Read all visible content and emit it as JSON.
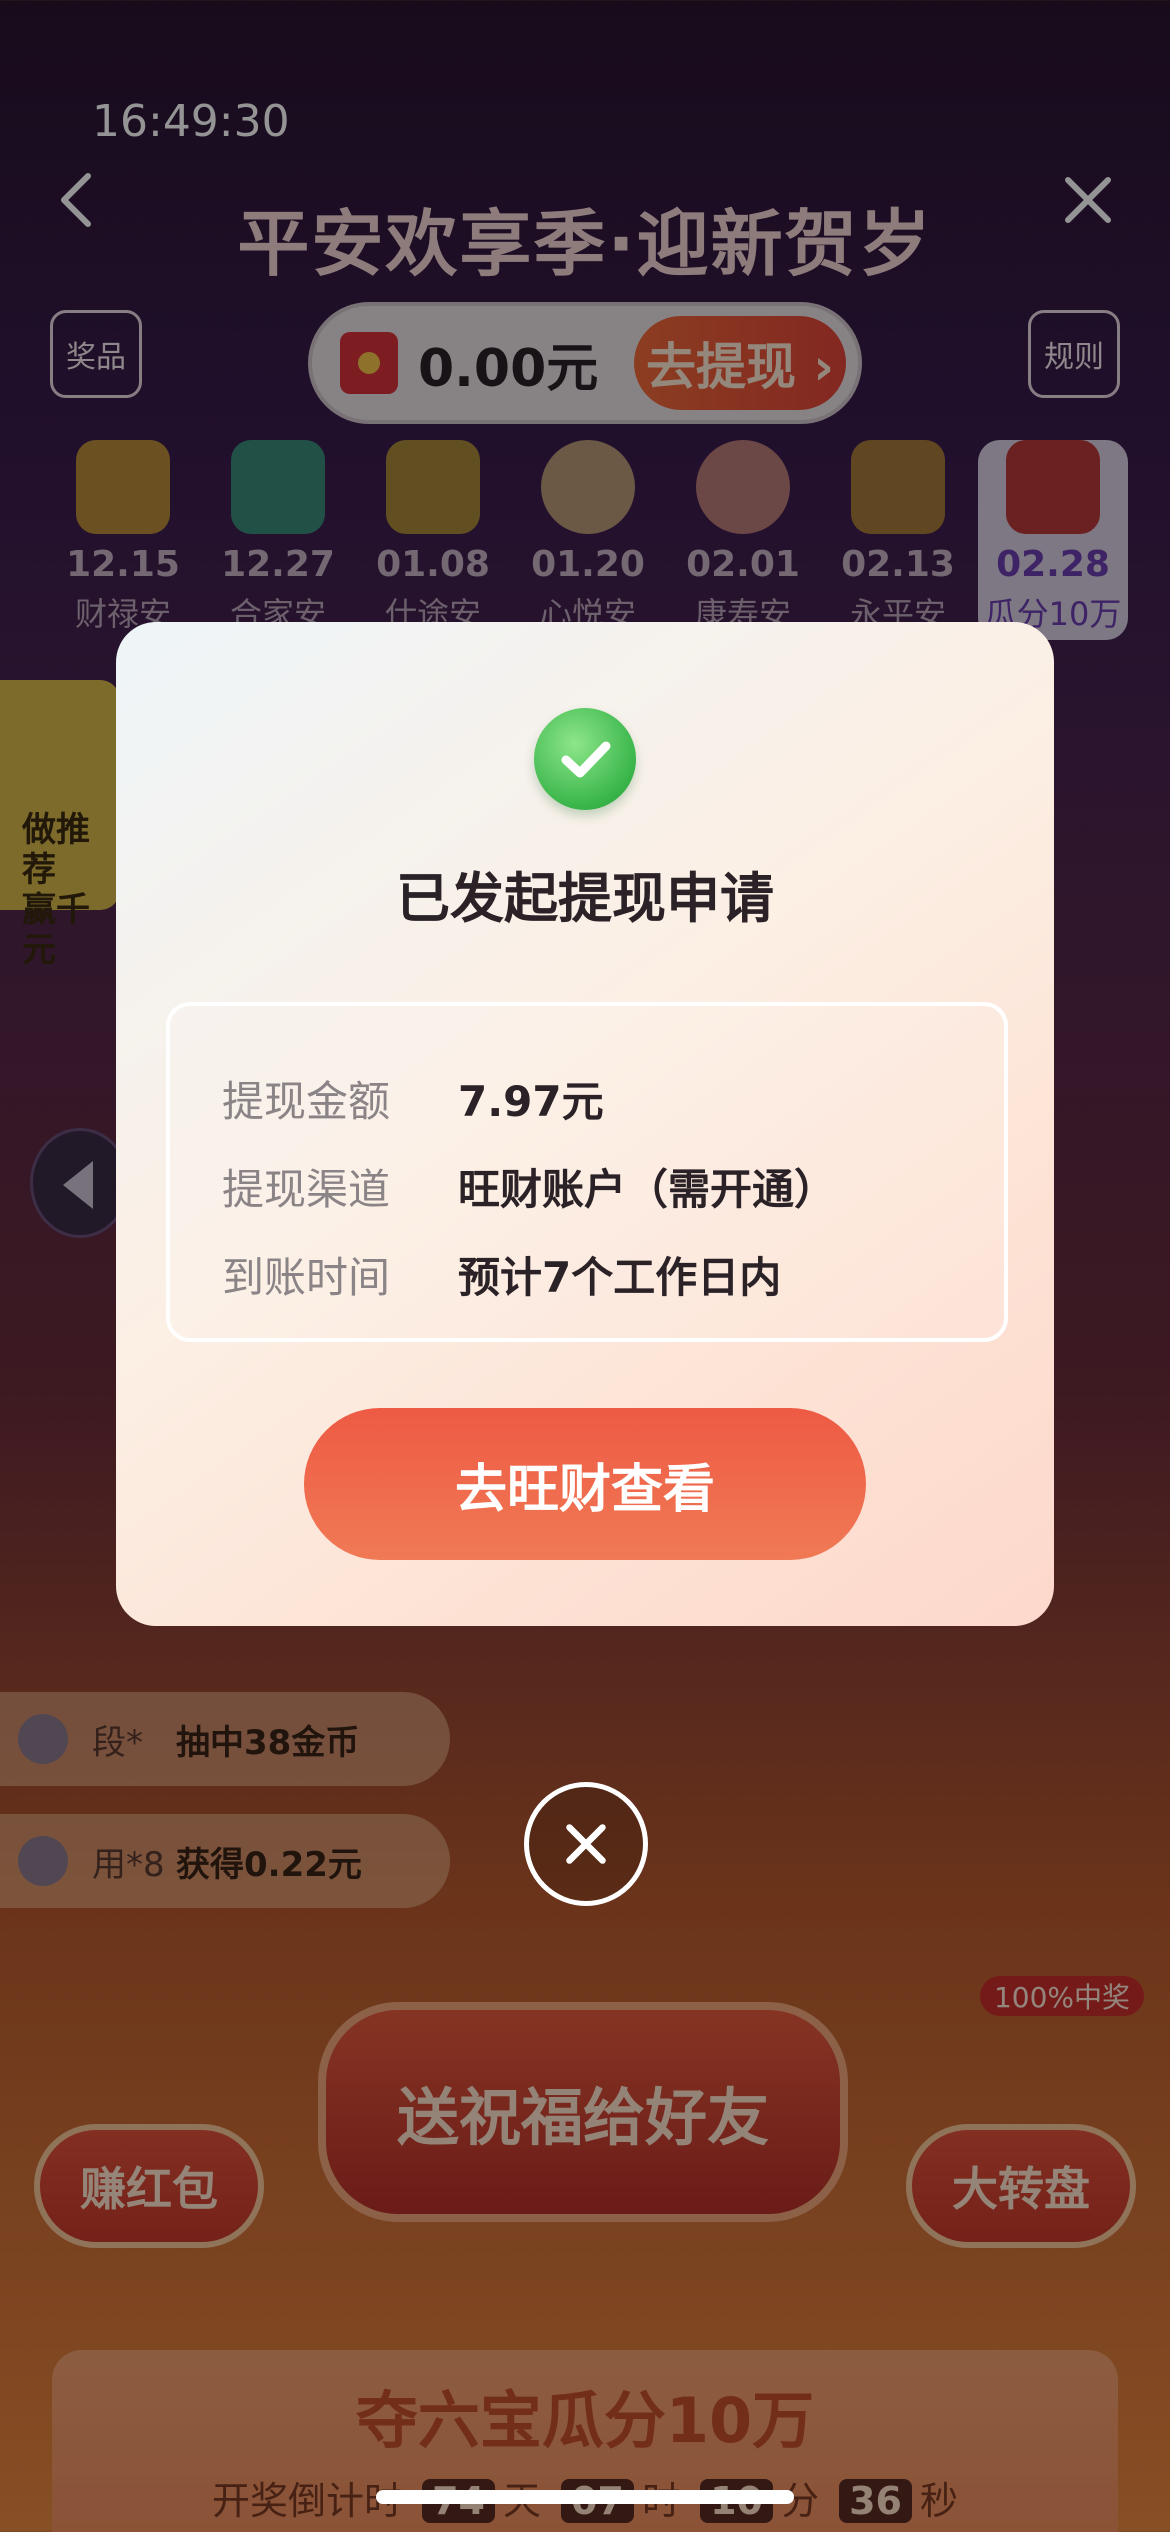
{
  "status_bar": {
    "time": "16:49:30"
  },
  "header": {
    "title": "平安欢享季·迎新贺岁",
    "back_icon": "chevron-left-icon",
    "close_icon": "close-icon"
  },
  "top_bar": {
    "prize_label": "奖品",
    "rules_label": "规则",
    "balance": "0.00元",
    "withdraw_label": "去提现 ›"
  },
  "calendar": [
    {
      "date": "12.15",
      "name": "财禄安",
      "icon": "gold-ingot-icon",
      "color": "#d9a93a"
    },
    {
      "date": "12.27",
      "name": "合家安",
      "icon": "photo-frame-icon",
      "color": "#3ab59a"
    },
    {
      "date": "01.08",
      "name": "仕途安",
      "icon": "crown-icon",
      "color": "#e0b23a"
    },
    {
      "date": "01.20",
      "name": "心悦安",
      "icon": "buddha-icon",
      "color": "#f0c490"
    },
    {
      "date": "02.01",
      "name": "康寿安",
      "icon": "peach-icon",
      "color": "#f4a8a0"
    },
    {
      "date": "02.13",
      "name": "永平安",
      "icon": "chinese-knot-icon",
      "color": "#e0a040"
    },
    {
      "date": "02.28",
      "name": "瓜分10万",
      "icon": "red-envelope-icon",
      "color": "#d9323a"
    }
  ],
  "side_promo": {
    "line1": "做推荐",
    "line2": "赢千元"
  },
  "tickers": [
    {
      "name": "段*",
      "text": "抽中38金币"
    },
    {
      "name": "用*8",
      "text": "获得0.22元"
    }
  ],
  "bottom": {
    "badge": "100%中奖",
    "left_button": "赚红包",
    "main_button": "送祝福给好友",
    "right_button": "大转盘",
    "card_title": "夺六宝瓜分10万",
    "countdown_label": "开奖倒计时",
    "days": "74",
    "days_unit": "天",
    "hours": "07",
    "hours_unit": "时",
    "minutes": "10",
    "minutes_unit": "分",
    "seconds": "36",
    "seconds_unit": "秒"
  },
  "modal": {
    "icon": "success-check-icon",
    "title": "已发起提现申请",
    "rows": [
      {
        "label": "提现金额",
        "value": "7.97元"
      },
      {
        "label": "提现渠道",
        "value": "旺财账户（需开通）"
      },
      {
        "label": "到账时间",
        "value": "预计7个工作日内"
      }
    ],
    "button": "去旺财查看",
    "close_icon": "close-circle-icon"
  },
  "colors": {
    "accent": "#ee5a44",
    "success": "#39b54a"
  }
}
